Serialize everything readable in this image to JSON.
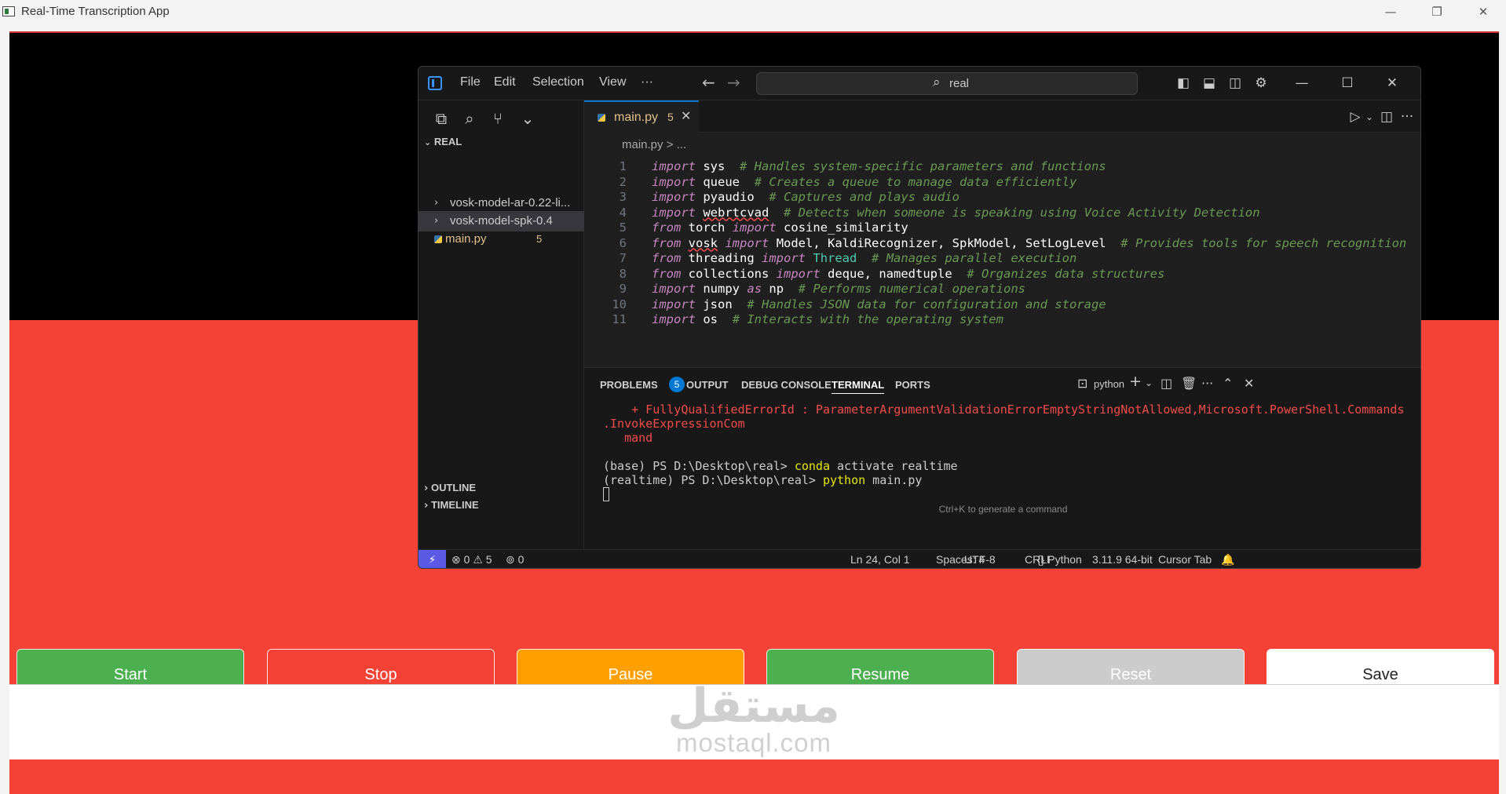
{
  "window": {
    "title": "Real-Time Transcription App",
    "minimize": "—",
    "restore": "❐",
    "close": "✕"
  },
  "controls": {
    "start": {
      "label": "Start",
      "bg": "#4caf50",
      "fg": "#ffffff"
    },
    "stop": {
      "label": "Stop",
      "bg": "#f44336",
      "fg": "#ffffff"
    },
    "pause": {
      "label": "Pause",
      "bg": "#ffa000",
      "fg": "#ffffff"
    },
    "resume": {
      "label": "Resume",
      "bg": "#4caf50",
      "fg": "#ffffff"
    },
    "reset": {
      "label": "Reset",
      "bg": "#cccccc",
      "fg": "#ffffff"
    },
    "save": {
      "label": "Save",
      "bg": "#ffffff",
      "fg": "#222222"
    }
  },
  "watermark": {
    "arabic": "مستقل",
    "latin": "mostaql.com"
  },
  "vscode": {
    "menu": [
      "File",
      "Edit",
      "Selection",
      "View",
      "···"
    ],
    "search": "real",
    "explorer": {
      "root": "REAL",
      "items": [
        {
          "name": "vosk-model-ar-0.22-li...",
          "type": "folder"
        },
        {
          "name": "vosk-model-spk-0.4",
          "type": "folder"
        },
        {
          "name": "main.py",
          "type": "file",
          "problems": "5"
        }
      ],
      "outline": "OUTLINE",
      "timeline": "TIMELINE"
    },
    "tab": {
      "name": "main.py",
      "problems": "5",
      "close": "✕"
    },
    "breadcrumb": "main.py > ...",
    "code_lines": [
      {
        "n": "1",
        "parts": [
          [
            "kw",
            "import"
          ],
          [
            "t",
            " "
          ],
          [
            "mod",
            "sys"
          ],
          [
            "t",
            "  "
          ],
          [
            "cmt",
            "# Handles system-specific parameters and functions"
          ]
        ]
      },
      {
        "n": "2",
        "parts": [
          [
            "kw",
            "import"
          ],
          [
            "t",
            " "
          ],
          [
            "mod",
            "queue"
          ],
          [
            "t",
            "  "
          ],
          [
            "cmt",
            "# Creates a queue to manage data efficiently"
          ]
        ]
      },
      {
        "n": "3",
        "parts": [
          [
            "kw",
            "import"
          ],
          [
            "t",
            " "
          ],
          [
            "mod",
            "pyaudio"
          ],
          [
            "t",
            "  "
          ],
          [
            "cmt",
            "# Captures and plays audio"
          ]
        ]
      },
      {
        "n": "4",
        "parts": [
          [
            "kw",
            "import"
          ],
          [
            "t",
            " "
          ],
          [
            "sq",
            "webrtcvad"
          ],
          [
            "t",
            "  "
          ],
          [
            "cmt",
            "# Detects when someone is speaking using Voice Activity Detection"
          ]
        ]
      },
      {
        "n": "5",
        "parts": [
          [
            "kw",
            "from"
          ],
          [
            "t",
            " "
          ],
          [
            "mod",
            "torch"
          ],
          [
            "t",
            " "
          ],
          [
            "kw",
            "import"
          ],
          [
            "t",
            " "
          ],
          [
            "mod",
            "cosine_similarity"
          ]
        ]
      },
      {
        "n": "6",
        "parts": [
          [
            "kw",
            "from"
          ],
          [
            "t",
            " "
          ],
          [
            "sq",
            "vosk"
          ],
          [
            "t",
            " "
          ],
          [
            "kw",
            "import"
          ],
          [
            "t",
            " "
          ],
          [
            "mod",
            "Model, KaldiRecognizer, SpkModel, SetLogLevel"
          ],
          [
            "t",
            "  "
          ],
          [
            "cmt",
            "# Provides tools for speech recognition"
          ]
        ]
      },
      {
        "n": "7",
        "parts": [
          [
            "kw",
            "from"
          ],
          [
            "t",
            " "
          ],
          [
            "mod",
            "threading"
          ],
          [
            "t",
            " "
          ],
          [
            "kw",
            "import"
          ],
          [
            "t",
            " "
          ],
          [
            "cls",
            "Thread"
          ],
          [
            "t",
            "  "
          ],
          [
            "cmt",
            "# Manages parallel execution"
          ]
        ]
      },
      {
        "n": "8",
        "parts": [
          [
            "kw",
            "from"
          ],
          [
            "t",
            " "
          ],
          [
            "mod",
            "collections"
          ],
          [
            "t",
            " "
          ],
          [
            "kw",
            "import"
          ],
          [
            "t",
            " "
          ],
          [
            "mod",
            "deque, namedtuple"
          ],
          [
            "t",
            "  "
          ],
          [
            "cmt",
            "# Organizes data structures"
          ]
        ]
      },
      {
        "n": "9",
        "parts": [
          [
            "kw",
            "import"
          ],
          [
            "t",
            " "
          ],
          [
            "mod",
            "numpy"
          ],
          [
            "t",
            " "
          ],
          [
            "kw",
            "as"
          ],
          [
            "t",
            " "
          ],
          [
            "mod",
            "np"
          ],
          [
            "t",
            "  "
          ],
          [
            "cmt",
            "# Performs numerical operations"
          ]
        ]
      },
      {
        "n": "10",
        "parts": [
          [
            "kw",
            "import"
          ],
          [
            "t",
            " "
          ],
          [
            "mod",
            "json"
          ],
          [
            "t",
            "  "
          ],
          [
            "cmt",
            "# Handles JSON data for configuration and storage"
          ]
        ]
      },
      {
        "n": "11",
        "parts": [
          [
            "kw",
            "import"
          ],
          [
            "t",
            " "
          ],
          [
            "mod",
            "os"
          ],
          [
            "t",
            "  "
          ],
          [
            "cmt",
            "# Interacts with the operating system"
          ]
        ]
      }
    ],
    "panel_tabs": {
      "problems": "PROBLEMS",
      "problems_count": "5",
      "output": "OUTPUT",
      "debug": "DEBUG CONSOLE",
      "terminal": "TERMINAL",
      "ports": "PORTS",
      "shell": "python"
    },
    "terminal": {
      "err1": "    + FullyQualifiedErrorId : ParameterArgumentValidationErrorEmptyStringNotAllowed,Microsoft.PowerShell.Commands",
      "err2": ".InvokeExpressionCom",
      "err3": "   mand",
      "l1_prompt": "(base) PS D:\\Desktop\\real> ",
      "l1_cmd": "conda",
      "l1_rest": " activate realtime",
      "l2_prompt": "(realtime) PS D:\\Desktop\\real> ",
      "l2_cmd": "python",
      "l2_rest": " main.py",
      "hint": "Ctrl+K to generate a command"
    },
    "status": {
      "errors": "0",
      "warnings": "5",
      "ports": "0",
      "position": "Ln 24, Col 1",
      "spaces": "Spaces: 4",
      "encoding": "UTF-8",
      "eol": "CRLF",
      "language": "Python",
      "interpreter": "3.11.9 64-bit",
      "cursor_tab": "Cursor Tab"
    }
  }
}
